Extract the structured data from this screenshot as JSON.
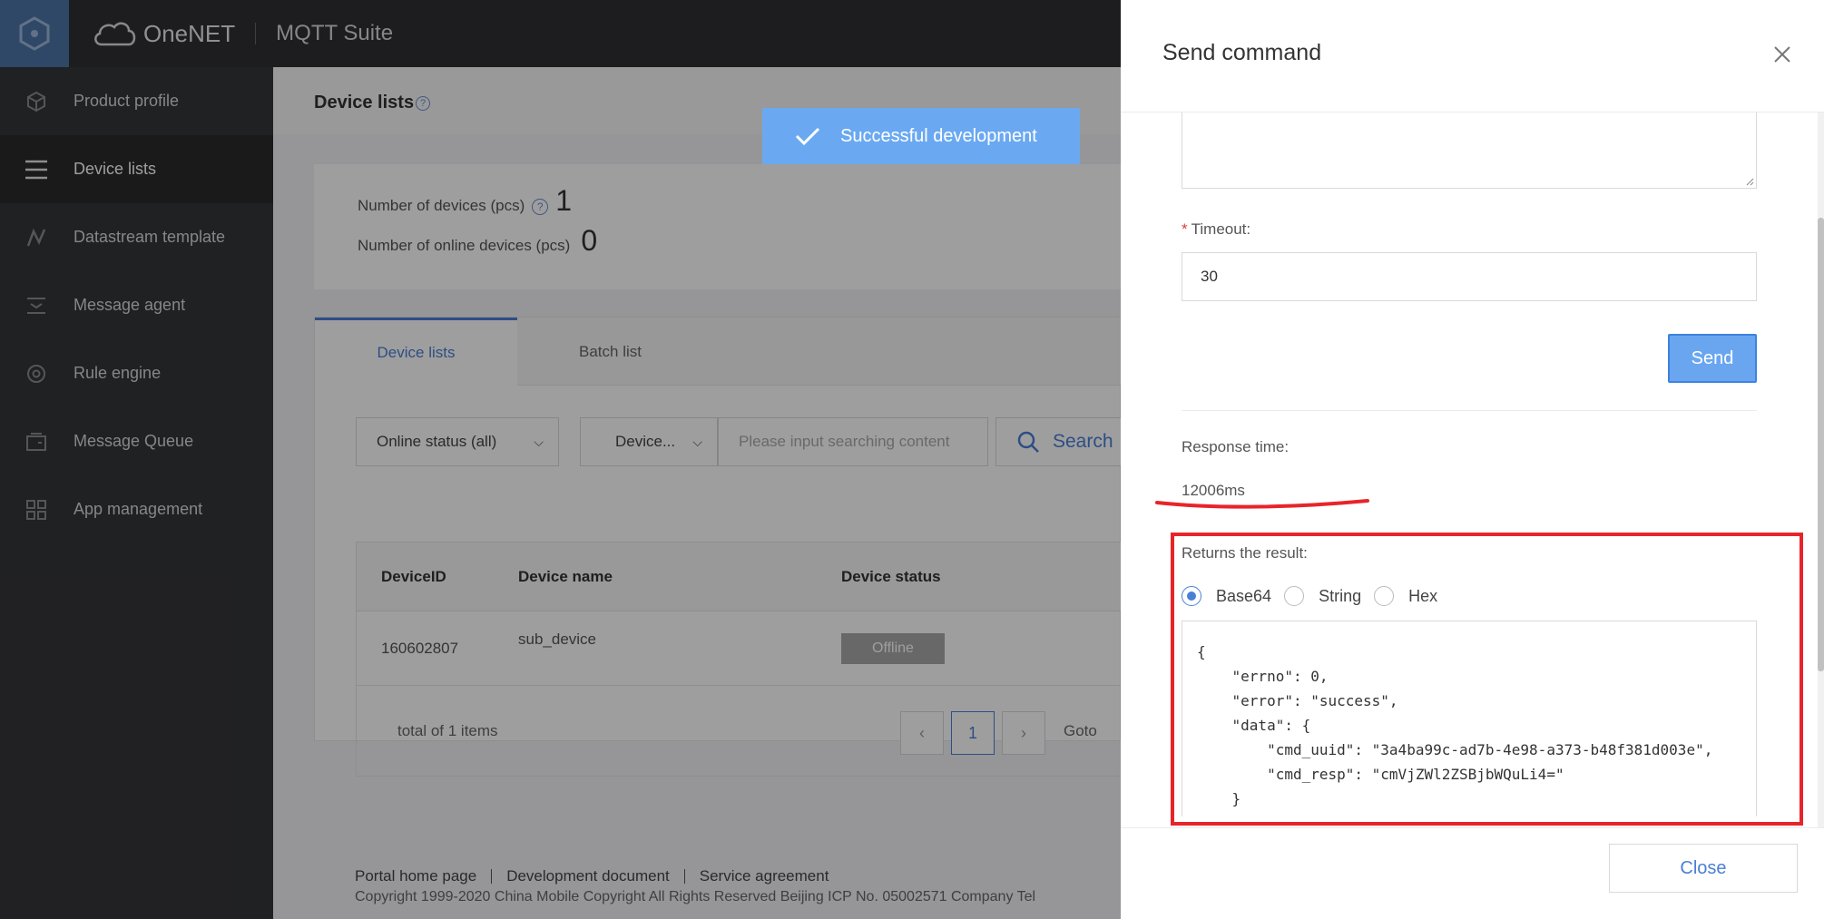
{
  "header": {
    "brand": "OneNET",
    "suite": "MQTT Suite",
    "icons": {
      "logo": "hexagon-logo-icon",
      "cloud": "cloud-logo-icon"
    }
  },
  "sidebar": {
    "items": [
      {
        "label": "Product profile",
        "icon": "cube-icon"
      },
      {
        "label": "Device lists",
        "icon": "list-icon",
        "active": true
      },
      {
        "label": "Datastream template",
        "icon": "datastream-icon"
      },
      {
        "label": "Message agent",
        "icon": "message-agent-icon"
      },
      {
        "label": "Rule engine",
        "icon": "rule-engine-icon"
      },
      {
        "label": "Message Queue",
        "icon": "message-queue-icon"
      },
      {
        "label": "App management",
        "icon": "app-grid-icon"
      }
    ]
  },
  "main": {
    "title": "Device lists",
    "stats": {
      "devices_label": "Number of devices (pcs)",
      "devices_value": "1",
      "online_label": "Number of online devices (pcs)",
      "online_value": "0"
    },
    "tabs": [
      {
        "label": "Device lists",
        "active": true
      },
      {
        "label": "Batch list"
      }
    ],
    "filters": {
      "status": "Online status (all)",
      "field": "Device...",
      "search_placeholder": "Please input searching content",
      "search_label": "Search"
    },
    "table": {
      "columns": [
        "DeviceID",
        "Device name",
        "Device status"
      ],
      "rows": [
        {
          "id": "160602807",
          "name": "sub_device",
          "status": "Offline"
        }
      ],
      "total": "total of 1 items",
      "page": "1",
      "goto": "Goto"
    },
    "footer": {
      "links": [
        "Portal home page",
        "Development document",
        "Service agreement"
      ],
      "copyright": "Copyright 1999-2020 China Mobile Copyright All Rights Reserved Beijing ICP No. 05002571 Company Tel"
    }
  },
  "toast": {
    "text": "Successful development"
  },
  "drawer": {
    "title": "Send command",
    "timeout_label": "Timeout:",
    "timeout_value": "30",
    "send_label": "Send",
    "response_time_label": "Response time:",
    "response_time_value": "12006ms",
    "result_label": "Returns the result:",
    "formats": [
      {
        "label": "Base64",
        "selected": true
      },
      {
        "label": "String"
      },
      {
        "label": "Hex"
      }
    ],
    "result_lines": [
      "{",
      "    \"errno\": 0,",
      "    \"error\": \"success\",",
      "    \"data\": {",
      "        \"cmd_uuid\": \"3a4ba99c-ad7b-4e98-a373-b48f381d003e\",",
      "        \"cmd_resp\": \"cmVjZWl2ZSBjbWQuLi4=\"",
      "    }"
    ],
    "close_label": "Close"
  },
  "colors": {
    "accent": "#4a7fd6",
    "highlight": "#e8242a",
    "toast": "#6aa9f2"
  }
}
